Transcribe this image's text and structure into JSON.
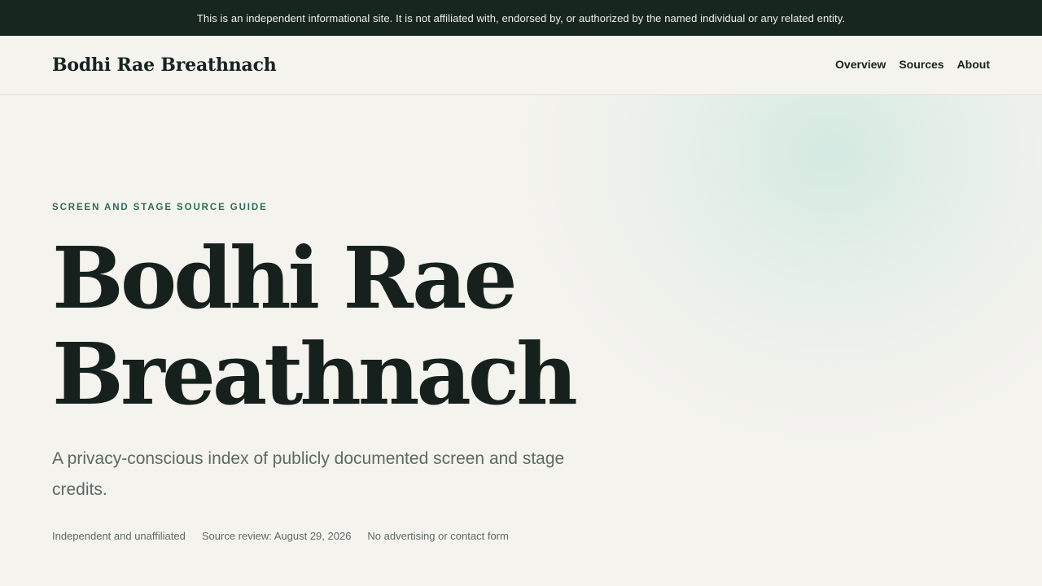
{
  "notice": {
    "text": "This is an independent informational site. It is not affiliated with, endorsed by, or authorized by the named individual or any related entity."
  },
  "header": {
    "brand": "Bodhi Rae Breathnach",
    "nav": [
      {
        "label": "Overview"
      },
      {
        "label": "Sources"
      },
      {
        "label": "About"
      }
    ]
  },
  "hero": {
    "eyebrow": "SCREEN AND STAGE SOURCE GUIDE",
    "title_line1": "Bodhi Rae",
    "title_line2": "Breathnach",
    "lede": "A privacy-conscious index of publicly documented screen and stage credits.",
    "meta": [
      "Independent and unaffiliated",
      "Source review: August 29, 2026",
      "No advertising or contact form"
    ]
  },
  "colors": {
    "notice_bg": "#17271f",
    "page_bg": "#f4f3ee",
    "accent": "#2f6b58",
    "text": "#16211d",
    "muted": "#5d6a64"
  }
}
